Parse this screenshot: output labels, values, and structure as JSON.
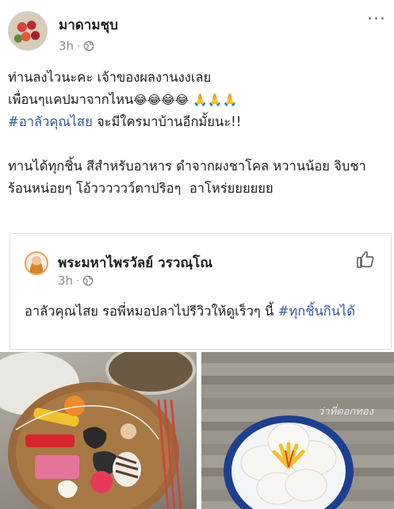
{
  "post": {
    "author": "มาดามชุบ",
    "time": "3h",
    "dot": "·",
    "more": "···",
    "line1": "ท่านลงไวนะคะ เจ้าของผลงานงงเลย",
    "line2_text": "เพื่อนๆแคปมาจากไหน",
    "line2_emoji": "😂😂😂😂 🙏🙏🙏",
    "hashtag": "#อาลัวคุณไสย",
    "line3_rest": " จะมีใครมาบ้านอีกมั้ยนะ!!",
    "paragraph2": "ทานได้ทุกชิ้น สีสำหรับอาหาร ดำจากผงชาโคล หวานน้อย จิบชาร้อนหน่อยๆ โอ้วววววว์ตาปริอๆ  อาโหร่ยยยยยย"
  },
  "shared": {
    "author": "พระมหาไพรวัลย์ วรวณฺโณ",
    "time": "3h",
    "dot": "·",
    "text": "อาลัวคุณไสย รอพี่หมอปลาไปรีวิวให้ดูเร็วๆ นี้ ",
    "hashtag": "#ทุกชิ้นกินได้"
  },
  "photos": {
    "watermark": "ว่าที่ดอกทอง"
  },
  "colors": {
    "hashtag": "#385898",
    "meta": "#8a8d91",
    "text": "#1c1e21"
  },
  "icons": [
    "globe-icon",
    "more-icon",
    "like-icon"
  ]
}
